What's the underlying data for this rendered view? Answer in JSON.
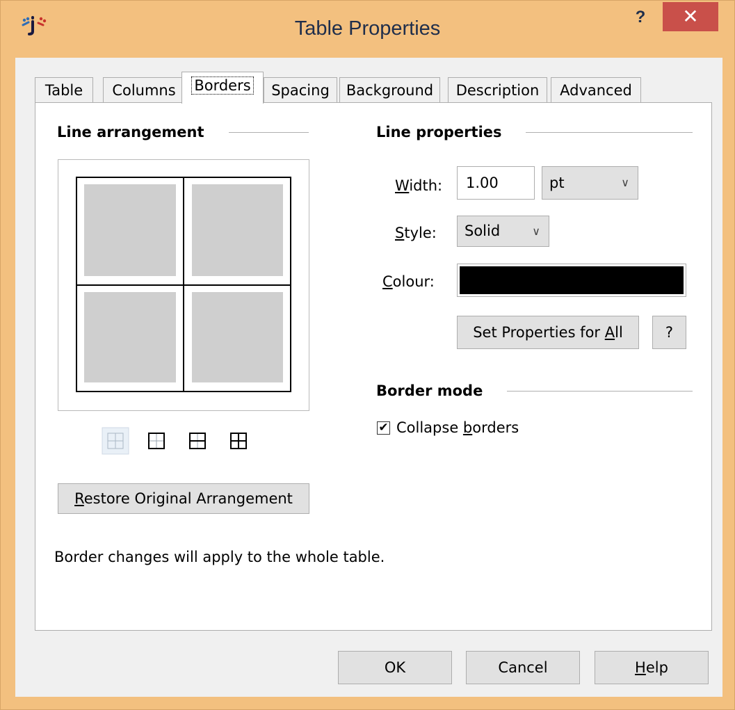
{
  "window": {
    "title": "Table Properties",
    "help_glyph": "?",
    "close_glyph": "✕"
  },
  "tabs": [
    {
      "label": "Table"
    },
    {
      "label": "Columns"
    },
    {
      "label": "Borders"
    },
    {
      "label": "Spacing"
    },
    {
      "label": "Background"
    },
    {
      "label": "Description"
    },
    {
      "label": "Advanced"
    }
  ],
  "active_tab": "Borders",
  "line_arrangement": {
    "title": "Line arrangement",
    "restore": {
      "pre": "",
      "mnemonic": "R",
      "post": "estore Original Arrangement"
    }
  },
  "line_properties": {
    "title": "Line properties",
    "width": {
      "mnemonic": "W",
      "post": "idth:",
      "value": "1.00",
      "unit": "pt"
    },
    "style": {
      "mnemonic": "S",
      "post": "tyle:",
      "value": "Solid"
    },
    "colour": {
      "mnemonic": "C",
      "post": "olour:",
      "value": "#000000"
    },
    "set_all": {
      "pre": "Set Properties for ",
      "mnemonic": "A",
      "post": "ll"
    },
    "help": "?"
  },
  "border_mode": {
    "title": "Border mode",
    "collapse": {
      "pre": "Collapse ",
      "mnemonic": "b",
      "post": "orders",
      "checked": true
    }
  },
  "info_text": "Border changes will apply to the whole table.",
  "buttons": {
    "ok": "OK",
    "cancel": "Cancel",
    "help": {
      "mnemonic": "H",
      "post": "elp"
    }
  }
}
